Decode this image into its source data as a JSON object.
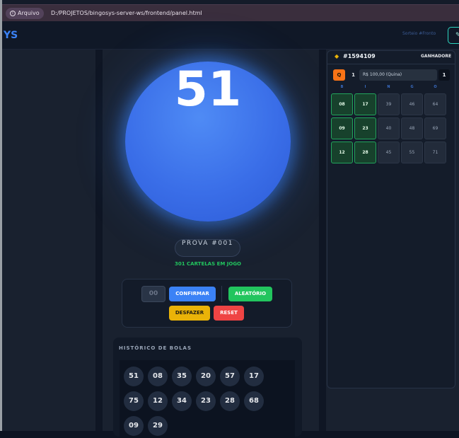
{
  "browser": {
    "chip_label": "Arquivo",
    "url": "D:/PROJETOS/bingosys-server-ws/frontend/panel.html"
  },
  "header": {
    "logo": "YS",
    "nav_link": "Sorteio #Fronto"
  },
  "draw": {
    "current_ball": "51",
    "prova_label": "PROVA #001",
    "cartelas_label": "301 CARTELAS EM JOGO"
  },
  "controls": {
    "input_placeholder": "00",
    "confirm_label": "CONFIRMAR",
    "random_label": "ALEATÓRIO",
    "undo_label": "DESFAZER",
    "reset_label": "RESET"
  },
  "history": {
    "title": "HISTÓRICO DE BOLAS",
    "balls": [
      "51",
      "08",
      "35",
      "20",
      "57",
      "17",
      "75",
      "12",
      "34",
      "23",
      "28",
      "68",
      "09",
      "29"
    ]
  },
  "card": {
    "id": "#1594109",
    "status": "GANHADORE",
    "badge_letter": "Q",
    "badge_count": "1",
    "prize": "R$ 100,00 (Quina)",
    "prize_count": "1",
    "letters": [
      "B",
      "I",
      "N",
      "G",
      "O"
    ],
    "rows": [
      [
        {
          "v": "08",
          "m": true
        },
        {
          "v": "17",
          "m": true
        },
        {
          "v": "39",
          "m": false
        },
        {
          "v": "46",
          "m": false
        },
        {
          "v": "64",
          "m": false
        }
      ],
      [
        {
          "v": "09",
          "m": true
        },
        {
          "v": "23",
          "m": true
        },
        {
          "v": "40",
          "m": false
        },
        {
          "v": "48",
          "m": false
        },
        {
          "v": "69",
          "m": false
        }
      ],
      [
        {
          "v": "12",
          "m": true
        },
        {
          "v": "28",
          "m": true
        },
        {
          "v": "45",
          "m": false
        },
        {
          "v": "55",
          "m": false
        },
        {
          "v": "71",
          "m": false
        }
      ]
    ]
  },
  "colors": {
    "accent": "#3b82f6",
    "success": "#22c55e",
    "warning": "#eab308",
    "danger": "#ef4444",
    "badge": "#f97316"
  }
}
